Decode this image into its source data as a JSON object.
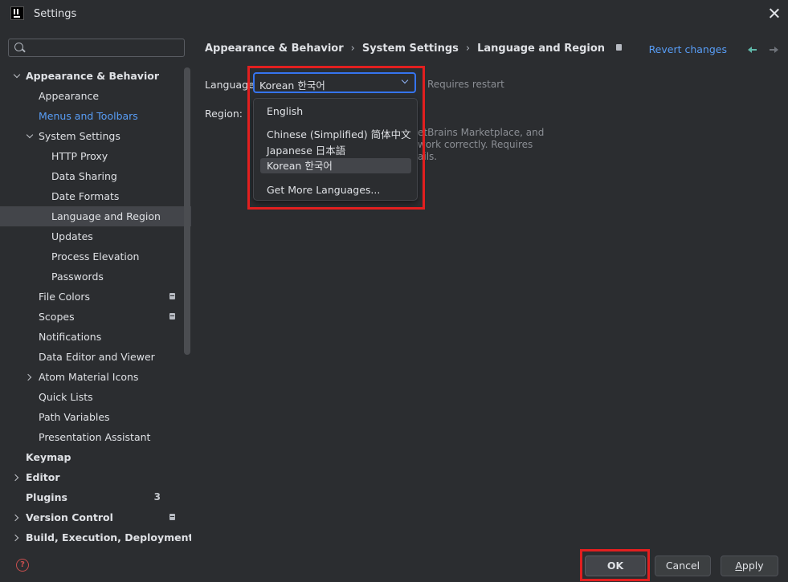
{
  "window": {
    "title": "Settings"
  },
  "sidebar": {
    "search_placeholder": "",
    "items": [
      {
        "label": "Appearance & Behavior",
        "expanded": true
      },
      {
        "label": "Appearance"
      },
      {
        "label": "Menus and Toolbars",
        "state": "modified"
      },
      {
        "label": "System Settings",
        "expanded": true
      },
      {
        "label": "HTTP Proxy"
      },
      {
        "label": "Data Sharing"
      },
      {
        "label": "Date Formats"
      },
      {
        "label": "Language and Region",
        "selected": true
      },
      {
        "label": "Updates"
      },
      {
        "label": "Process Elevation"
      },
      {
        "label": "Passwords"
      },
      {
        "label": "File Colors",
        "badge": "project-icon"
      },
      {
        "label": "Scopes",
        "badge": "project-icon"
      },
      {
        "label": "Notifications"
      },
      {
        "label": "Data Editor and Viewer"
      },
      {
        "label": "Atom Material Icons",
        "expanded": false
      },
      {
        "label": "Quick Lists"
      },
      {
        "label": "Path Variables"
      },
      {
        "label": "Presentation Assistant"
      },
      {
        "label": "Keymap"
      },
      {
        "label": "Editor",
        "expanded": false
      },
      {
        "label": "Plugins",
        "count": "3"
      },
      {
        "label": "Version Control",
        "expanded": false,
        "badge": "project-icon"
      },
      {
        "label": "Build, Execution, Deployment",
        "expanded": false
      }
    ]
  },
  "breadcrumb": [
    "Appearance & Behavior",
    "System Settings",
    "Language and Region"
  ],
  "header": {
    "revert_label": "Revert changes"
  },
  "form": {
    "language_label": "Language:",
    "language_value": "Korean 한국어",
    "requires_restart": "Requires restart",
    "region_label": "Region:",
    "region_desc_lines": [
      "etBrains Marketplace, and",
      "work correctly. Requires",
      "ails."
    ]
  },
  "dropdown": {
    "options": [
      "English",
      "Chinese (Simplified) 简体中文",
      "Japanese 日本語",
      "Korean 한국어",
      "Get More Languages..."
    ],
    "selected": "Korean 한국어"
  },
  "buttons": {
    "ok": "OK",
    "cancel": "Cancel",
    "apply": "Apply"
  },
  "colors": {
    "accent": "#3574f0",
    "link": "#589df6",
    "annotation": "#e21f1f",
    "background": "#2b2d30"
  }
}
